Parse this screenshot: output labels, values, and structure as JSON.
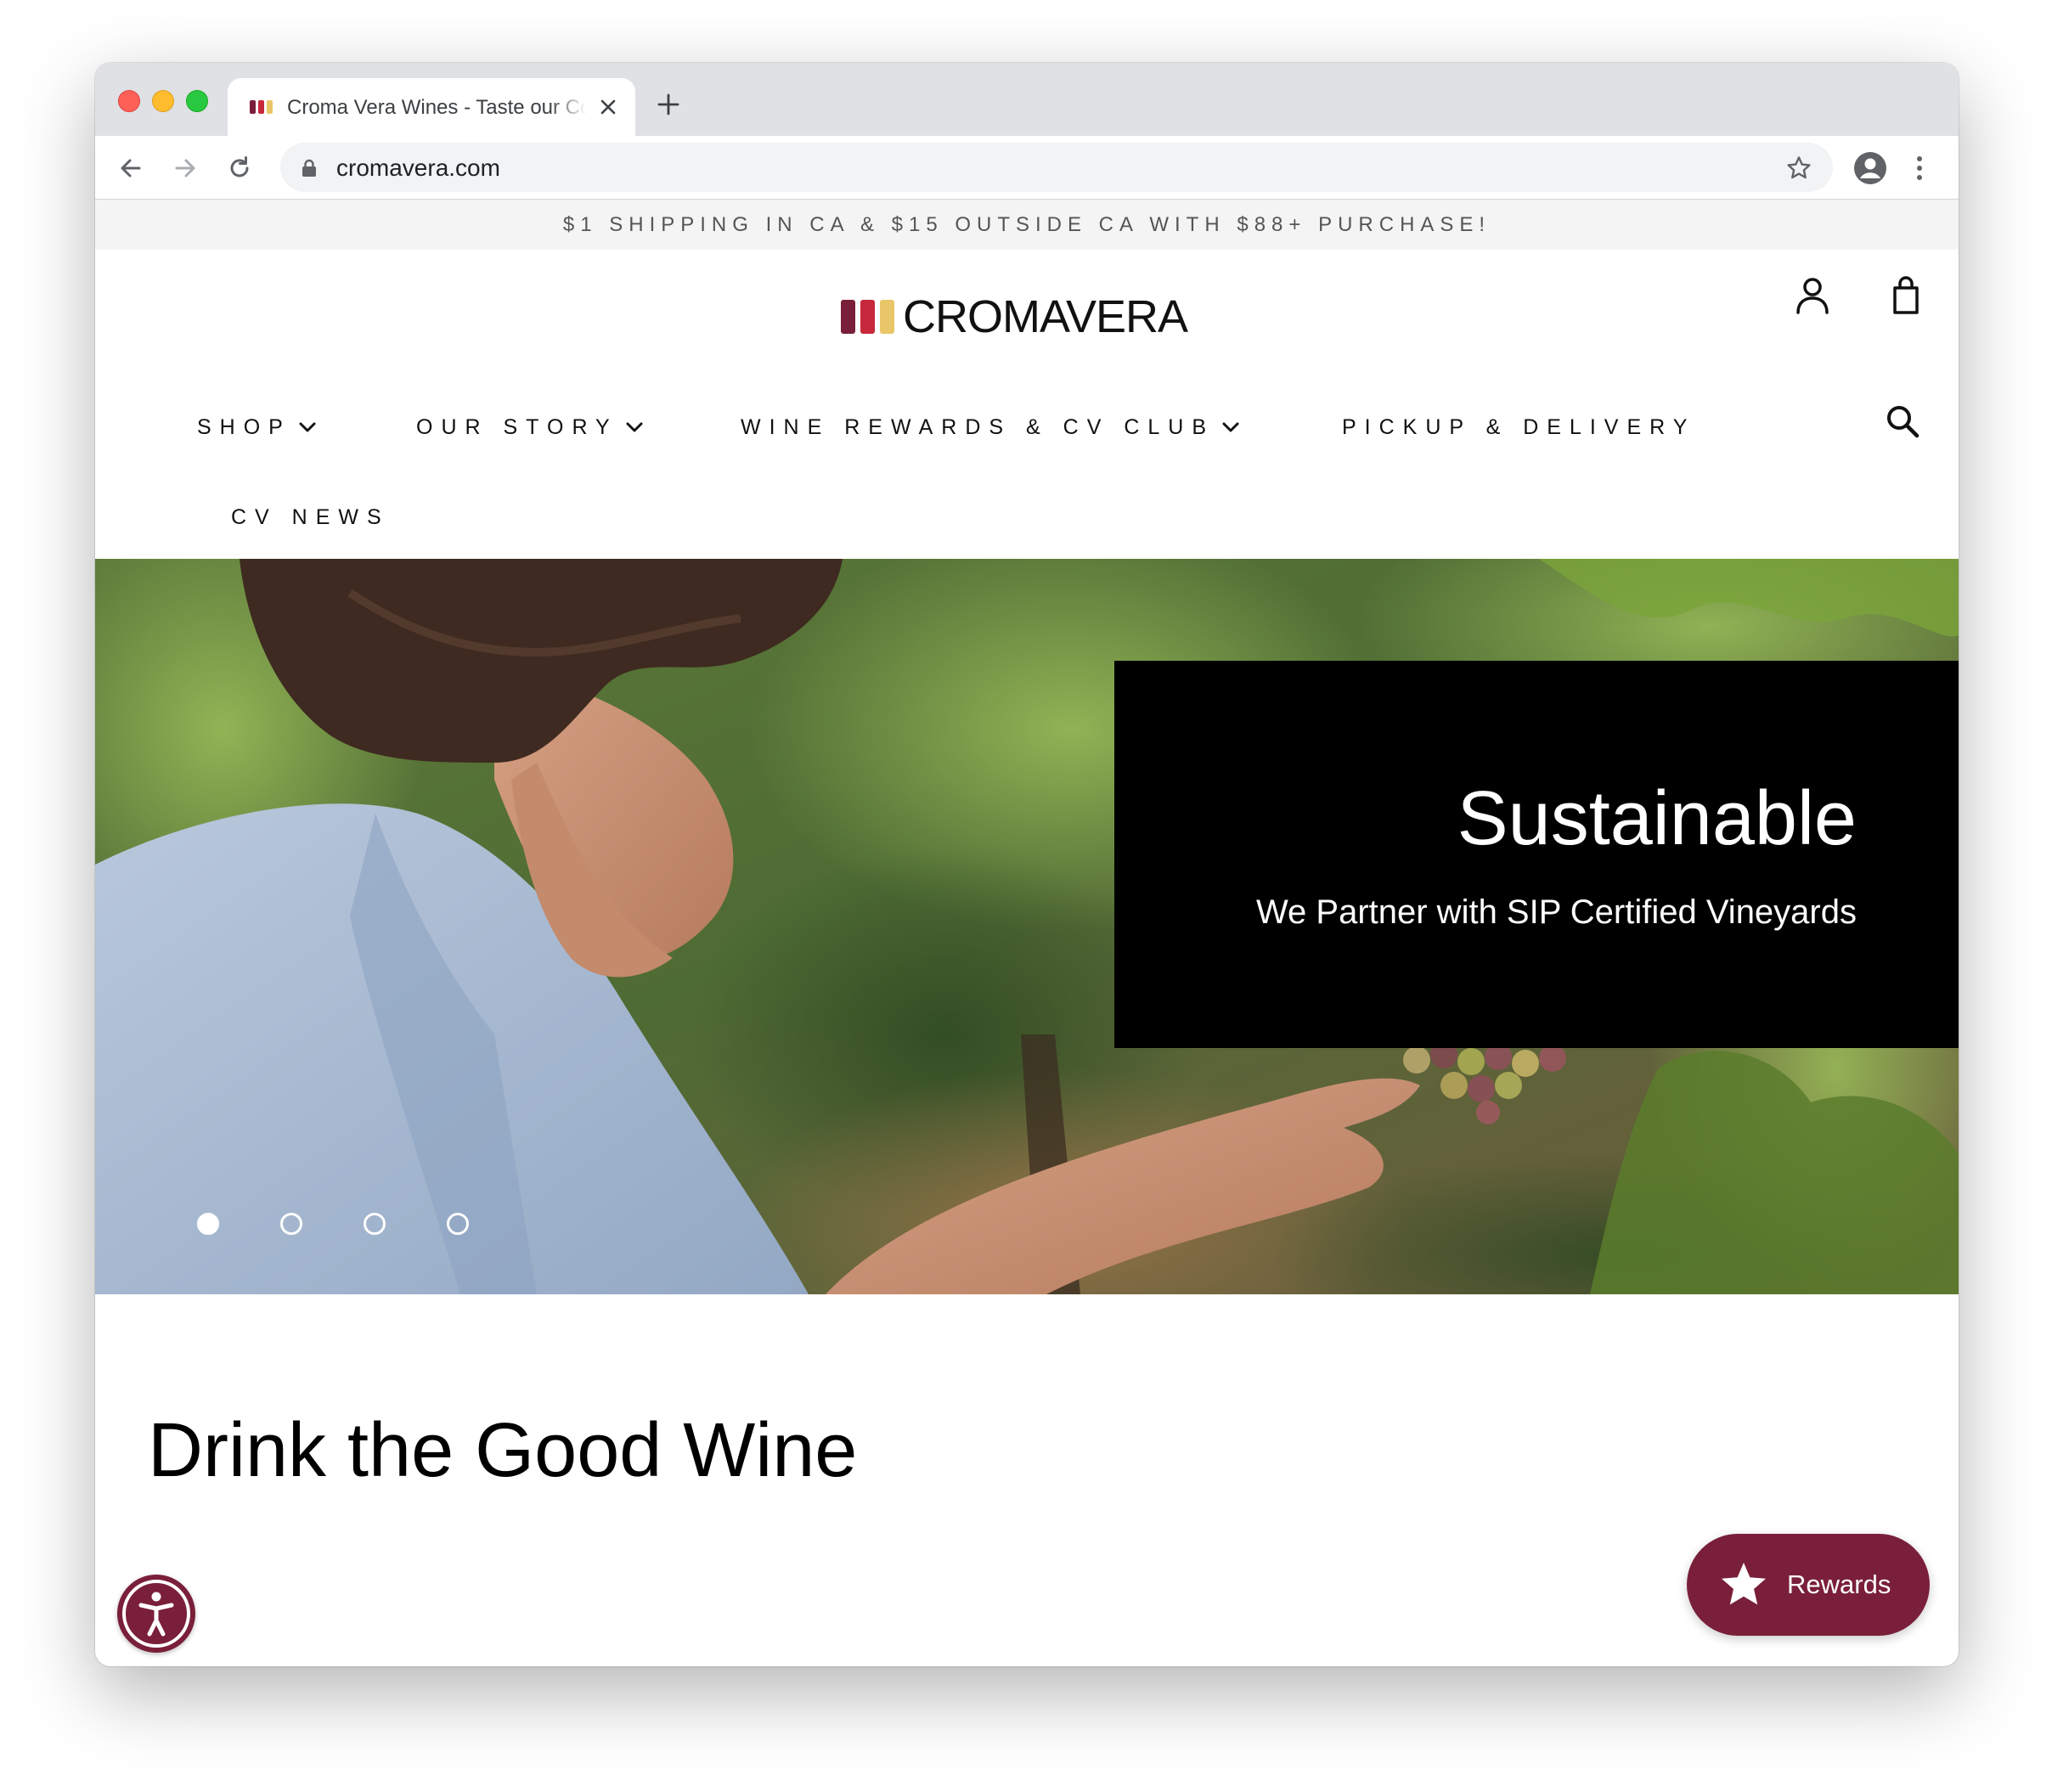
{
  "browser": {
    "tab_title": "Croma Vera Wines - Taste our Collection",
    "url": "cromavera.com"
  },
  "announcement": "$1 SHIPPING IN CA & $15 OUTSIDE CA WITH $88+ PURCHASE!",
  "logo": {
    "text_primary": "CROMA",
    "text_secondary": "VERA",
    "bar_colors": [
      "#7a1f3a",
      "#c8283c",
      "#e9c667"
    ]
  },
  "nav": {
    "items": [
      {
        "label": "SHOP",
        "has_dropdown": true
      },
      {
        "label": "OUR STORY",
        "has_dropdown": true
      },
      {
        "label": "WINE REWARDS & CV CLUB",
        "has_dropdown": true
      },
      {
        "label": "PICKUP & DELIVERY",
        "has_dropdown": false
      },
      {
        "label": "CV NEWS",
        "has_dropdown": false
      }
    ],
    "icons": [
      "account-icon",
      "cart-icon",
      "search-icon"
    ]
  },
  "hero": {
    "title": "Sustainable",
    "subtitle": "We Partner with SIP Certified Vineyards",
    "slide_count": 4,
    "active_slide": 1
  },
  "main": {
    "headline": "Drink the Good Wine"
  },
  "widgets": {
    "rewards_label": "Rewards",
    "accessibility_icon": "accessibility-icon",
    "brand_color": "#7a1f3a"
  }
}
